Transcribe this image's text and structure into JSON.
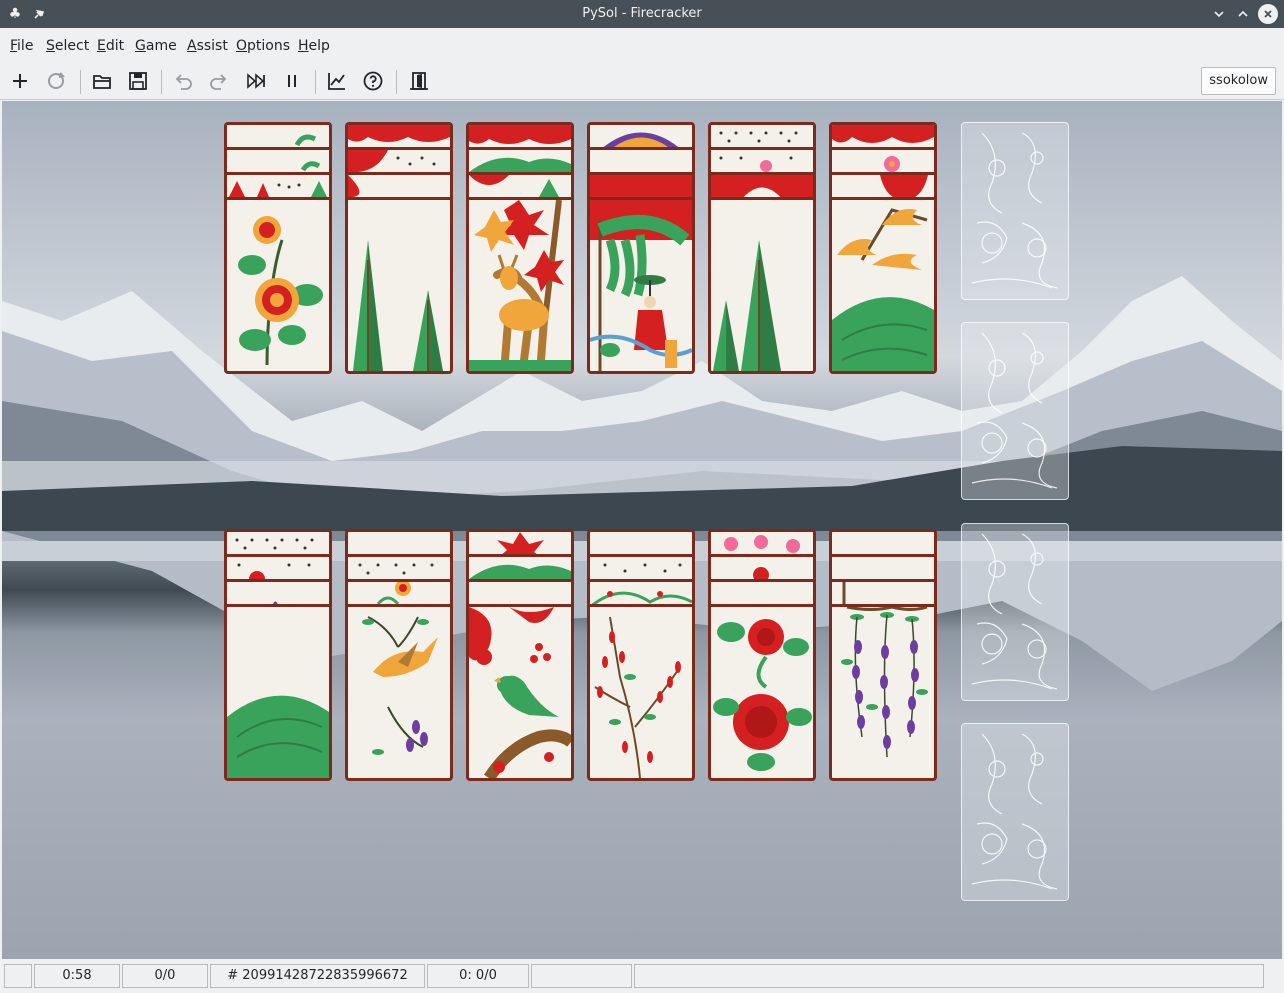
{
  "window": {
    "title": "PySol - Firecracker"
  },
  "menu": [
    {
      "accel": "F",
      "rest": "ile"
    },
    {
      "accel": "S",
      "rest": "elect"
    },
    {
      "accel": "E",
      "rest": "dit"
    },
    {
      "accel": "G",
      "rest": "ame"
    },
    {
      "accel": "A",
      "rest": "ssist"
    },
    {
      "accel": "O",
      "rest": "ptions"
    },
    {
      "accel": "H",
      "rest": "elp"
    }
  ],
  "toolbar": {
    "icons": [
      "new-game-icon",
      "restart-icon",
      "open-icon",
      "save-icon",
      "undo-icon",
      "redo-icon",
      "autodrop-icon",
      "pause-icon",
      "statistics-icon",
      "rules-icon",
      "quit-icon"
    ],
    "player_name": "ssokolow"
  },
  "game": {
    "tableau_top": [
      "chrysanthemum",
      "pine",
      "maple-deer",
      "willow-rain-man",
      "pine",
      "cherry-curtain"
    ],
    "tableau_bottom": [
      "susuki-grass",
      "wisteria-cuckoo",
      "plum-warbler",
      "bush-clover",
      "peony",
      "wisteria"
    ],
    "foundations": 4
  },
  "status": {
    "time": "0:58",
    "moves": "0/0",
    "game_number": "# 20991428722835996672",
    "score": "0: 0/0"
  }
}
